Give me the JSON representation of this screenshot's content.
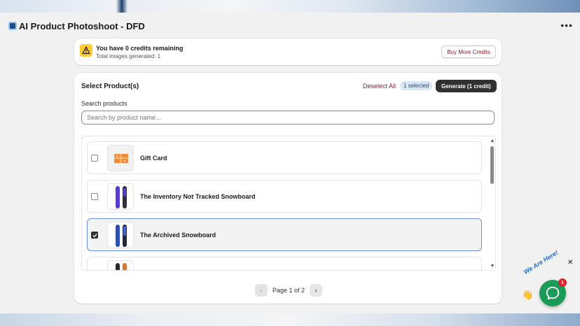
{
  "app": {
    "title": "AI Product Photoshoot - DFD",
    "more_icon": "ellipsis-icon"
  },
  "credits": {
    "title": "You have 0 credits remaining",
    "subtitle": "Total images generated: 1",
    "buy_label": "Buy More Credits",
    "warn_color": "#ffcc33"
  },
  "selection": {
    "title": "Select Product(s)",
    "deselect_label": "Deselect All",
    "selected_badge": "1 selected",
    "generate_label": "Generate (1 credit)"
  },
  "search": {
    "label": "Search products",
    "placeholder": "Search by product name..."
  },
  "products": [
    {
      "name": "Gift Card",
      "checked": false,
      "thumb": "gift-card"
    },
    {
      "name": "The Inventory Not Tracked Snowboard",
      "checked": false,
      "thumb": "purple-snowboard"
    },
    {
      "name": "The Archived Snowboard",
      "checked": true,
      "thumb": "blue-snowboard"
    },
    {
      "name": "",
      "checked": false,
      "thumb": "dark-snowboard"
    }
  ],
  "pagination": {
    "label": "Page 1 of 2"
  },
  "chat": {
    "text": "We Are Here!",
    "badge": "1",
    "color": "#1a9b57"
  }
}
